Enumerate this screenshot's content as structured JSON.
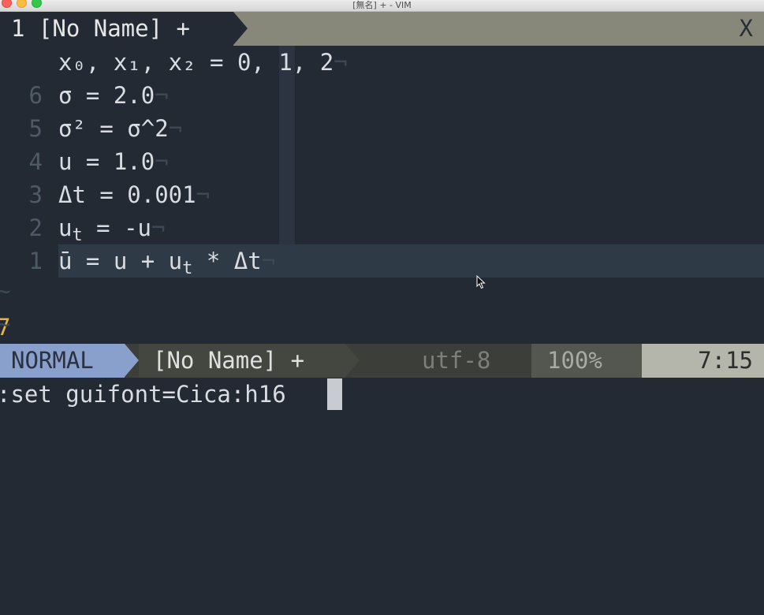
{
  "window": {
    "title": "[無名] + - VIM"
  },
  "tabline": {
    "active_tab": "1 [No Name] +",
    "close_label": "X"
  },
  "buffer": {
    "lines": [
      {
        "lnum": "6",
        "parts": [
          "x₀, x₁, x₂ = 0, 1, 2"
        ],
        "eol": "¬"
      },
      {
        "lnum": "5",
        "parts": [
          "σ = 2.0"
        ],
        "eol": "¬"
      },
      {
        "lnum": "4",
        "parts": [
          "σ² = σ^2"
        ],
        "eol": "¬"
      },
      {
        "lnum": "3",
        "parts": [
          "u = 1.0"
        ],
        "eol": "¬"
      },
      {
        "lnum": "2",
        "parts": [
          "Δt = 0.001"
        ],
        "eol": "¬"
      },
      {
        "lnum": "1",
        "pre": "u",
        "sub": "t",
        "post": " = -u",
        "eol": "¬"
      },
      {
        "lnum": "7",
        "pre": "ū = u + u",
        "sub": "t",
        "post": " * Δt",
        "eol": "¬"
      }
    ],
    "tilde": "~"
  },
  "statusline": {
    "mode": "NORMAL",
    "filename": "[No Name] +",
    "encoding": "utf-8",
    "percent": "100%",
    "position": "7:15"
  },
  "cmdline": {
    "text": ":set guifont=Cica:h16"
  },
  "colors": {
    "background": "#232a33",
    "mode_bg": "#8aa0cc",
    "current_line_number": "#e8b44a",
    "tabline_bg": "#87877a"
  }
}
